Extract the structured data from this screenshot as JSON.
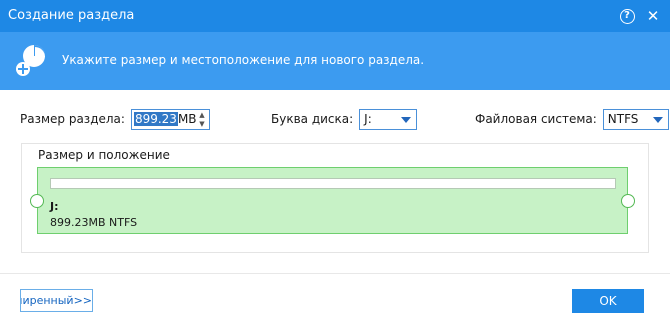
{
  "window": {
    "title": "Создание раздела",
    "help_icon": "help-icon",
    "help_glyph": "?",
    "close_icon": "close-icon",
    "close_glyph": "✕"
  },
  "banner": {
    "icon": "partition-add-icon",
    "text": "Укажите размер и местоположение для нового раздела."
  },
  "form": {
    "size_label": "Размер раздела:",
    "size_value": "899.23",
    "size_unit": "MB",
    "spin_up": "▲",
    "spin_down": "▼",
    "drive_label": "Буква диска:",
    "drive_value": "J:",
    "fs_label": "Файловая система:",
    "fs_value": "NTFS"
  },
  "layout_group": {
    "title": "Размер и положение",
    "partition": {
      "letter": "J:",
      "info": "899.23MB NTFS"
    }
  },
  "footer": {
    "advanced_label": "асширенный>>",
    "ok_label": "OK"
  },
  "colors": {
    "titlebar": "#1e88e5",
    "banner": "#3c9bf0",
    "partition_fill": "#c7f2c6",
    "partition_border": "#6ecf6e"
  }
}
